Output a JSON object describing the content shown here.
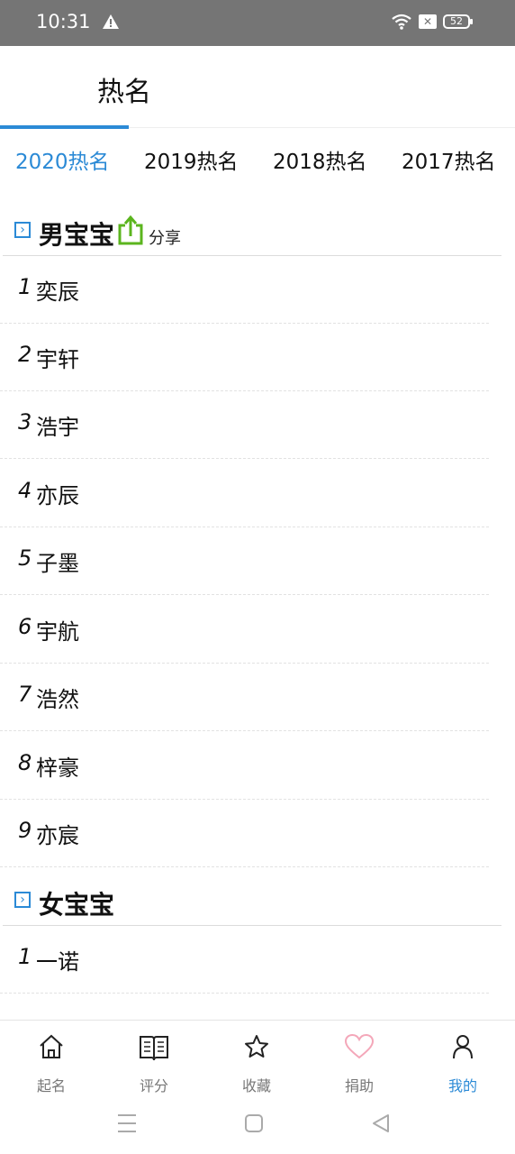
{
  "status_bar": {
    "time": "10:31",
    "battery": "52"
  },
  "header": {
    "title": "热名"
  },
  "year_tabs": [
    "2020热名",
    "2019热名",
    "2018热名",
    "2017热名"
  ],
  "sections": {
    "boy": {
      "title": "男宝宝",
      "share_label": "分享",
      "items": [
        {
          "rank": "1",
          "name": "奕辰"
        },
        {
          "rank": "2",
          "name": "宇轩"
        },
        {
          "rank": "3",
          "name": "浩宇"
        },
        {
          "rank": "4",
          "name": "亦辰"
        },
        {
          "rank": "5",
          "name": "子墨"
        },
        {
          "rank": "6",
          "name": "宇航"
        },
        {
          "rank": "7",
          "name": "浩然"
        },
        {
          "rank": "8",
          "name": "梓豪"
        },
        {
          "rank": "9",
          "name": "亦宸"
        }
      ]
    },
    "girl": {
      "title": "女宝宝",
      "items": [
        {
          "rank": "1",
          "name": "一诺"
        }
      ]
    }
  },
  "bottom_nav": [
    {
      "label": "起名",
      "icon": "home-icon"
    },
    {
      "label": "评分",
      "icon": "book-icon"
    },
    {
      "label": "收藏",
      "icon": "star-icon"
    },
    {
      "label": "捐助",
      "icon": "heart-icon"
    },
    {
      "label": "我的",
      "icon": "user-icon"
    }
  ],
  "colors": {
    "accent": "#2b8ad6",
    "share_green": "#5bb51e",
    "heart_pink": "#f4a7b9",
    "status_bar": "#757575"
  }
}
